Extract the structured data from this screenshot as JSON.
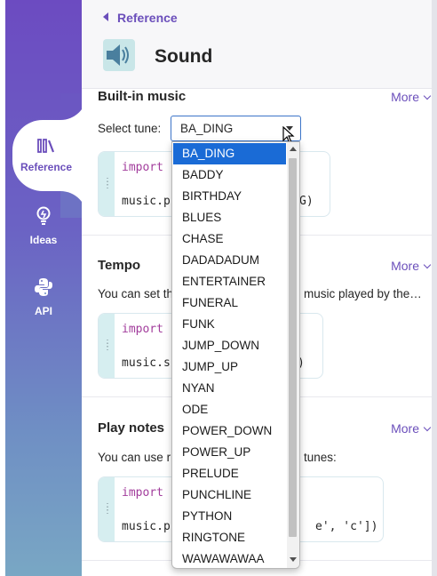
{
  "sidebar": {
    "items": [
      {
        "label": "Reference",
        "icon": "reference-icon",
        "active": true
      },
      {
        "label": "Ideas",
        "icon": "lightbulb-icon",
        "active": false
      },
      {
        "label": "API",
        "icon": "python-icon",
        "active": false
      }
    ]
  },
  "header": {
    "breadcrumb": "Reference",
    "title": "Sound",
    "icon": "speaker-icon"
  },
  "sections": {
    "builtin": {
      "title": "Built-in music",
      "more": "More",
      "select_label": "Select tune:",
      "selected_tune": "BA_DING",
      "code_line1": "import",
      "code_line2_left": "music.p",
      "code_line2_right": "G)"
    },
    "tempo": {
      "title": "Tempo",
      "more": "More",
      "desc_left": "You can set th",
      "desc_right": "music played by the…",
      "code_line1": "import",
      "code_line2_left": "music.s",
      "code_line2_right": ")"
    },
    "play_notes": {
      "title": "Play notes",
      "more": "More",
      "desc_left": "You can use r",
      "desc_right": "tunes:",
      "code_line1": "import",
      "code_line2_left": "music.p",
      "code_line2_right": "e', 'c'])"
    }
  },
  "dropdown": {
    "options": [
      "BA_DING",
      "BADDY",
      "BIRTHDAY",
      "BLUES",
      "CHASE",
      "DADADADUM",
      "ENTERTAINER",
      "FUNERAL",
      "FUNK",
      "JUMP_DOWN",
      "JUMP_UP",
      "NYAN",
      "ODE",
      "POWER_DOWN",
      "POWER_UP",
      "PRELUDE",
      "PUNCHLINE",
      "PYTHON",
      "RINGTONE",
      "WAWAWAWAA"
    ],
    "selected_index": 0
  },
  "colors": {
    "accent": "#6b4fbb",
    "selection": "#1a6bd6",
    "code_keyword": "#a23d9c"
  }
}
